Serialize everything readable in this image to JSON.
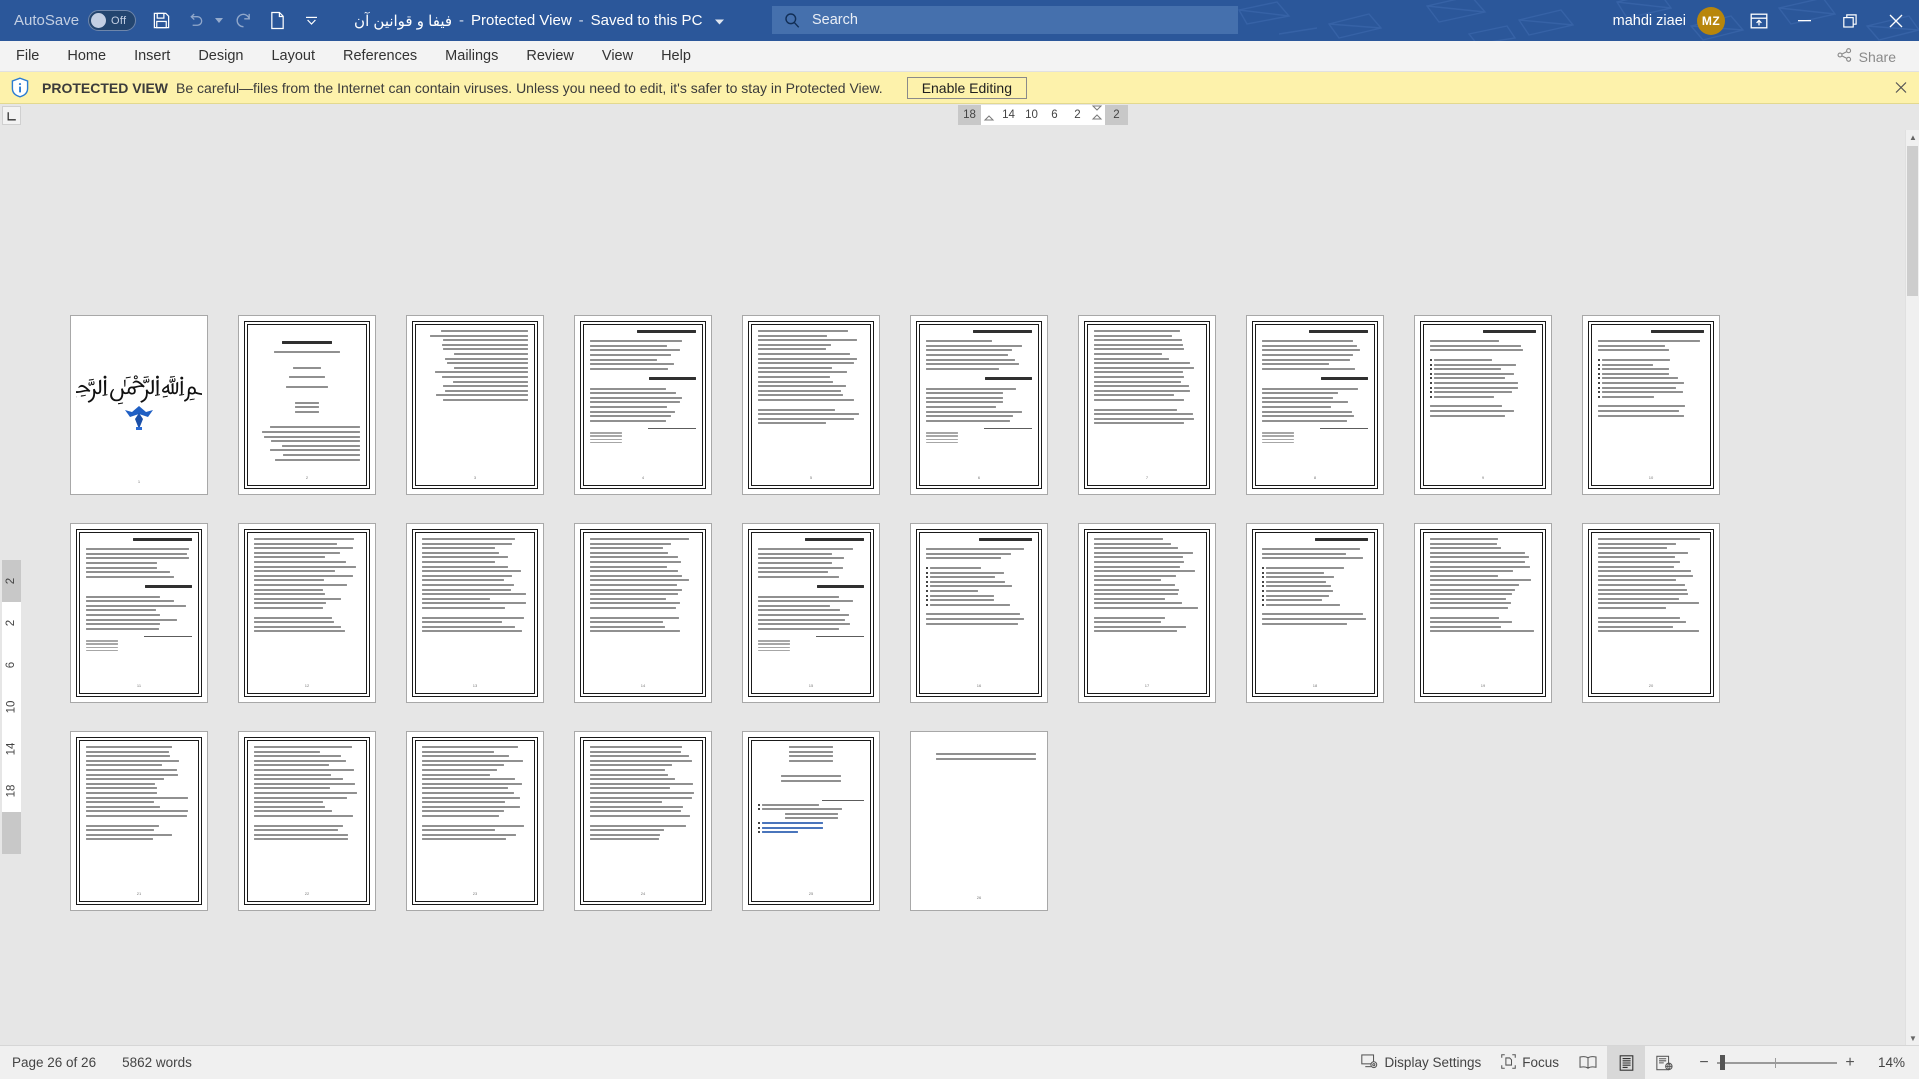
{
  "titlebar": {
    "autosave_label": "AutoSave",
    "autosave_state": "Off",
    "save_icon": "save-icon",
    "undo_icon": "undo-icon",
    "redo_icon": "redo-icon",
    "new_icon": "new-document-icon",
    "customize_icon": "customize-quick-access-toolbar-icon",
    "doc_name": "فیفا و قوانین آن",
    "sep": "-",
    "protected_view": "Protected View",
    "save_location": "Saved to this PC",
    "username": "mahdi ziaei",
    "avatar_initials": "MZ",
    "avatar_color": "#b8860b",
    "bar_color": "#2b579a",
    "ribbon_display_icon": "ribbon-display-options-icon",
    "minimize_icon": "minimize-icon",
    "restore_icon": "restore-icon",
    "close_icon": "close-icon"
  },
  "search": {
    "placeholder": "Search",
    "icon": "search-icon"
  },
  "ribbon": {
    "tabs": [
      {
        "label": "File"
      },
      {
        "label": "Home"
      },
      {
        "label": "Insert"
      },
      {
        "label": "Design"
      },
      {
        "label": "Layout"
      },
      {
        "label": "References"
      },
      {
        "label": "Mailings"
      },
      {
        "label": "Review"
      },
      {
        "label": "View"
      },
      {
        "label": "Help"
      }
    ],
    "share_label": "Share",
    "share_icon": "share-icon"
  },
  "protected_view_bar": {
    "icon": "shield-info-icon",
    "title": "PROTECTED VIEW",
    "message": "Be careful—files from the Internet can contain viruses. Unless you need to edit, it's safer to stay in Protected View.",
    "button_label": "Enable Editing",
    "close_icon": "close-icon",
    "background": "#fdf2ab"
  },
  "rulers": {
    "corner_icon": "tab-selector-icon",
    "horizontal_ticks": [
      "18",
      "14",
      "10",
      "6",
      "2",
      "2"
    ],
    "vertical_ticks": [
      "2",
      "2",
      "6",
      "10",
      "14",
      "18"
    ]
  },
  "statusbar": {
    "page_info": "Page 26 of 26",
    "word_count": "5862 words",
    "display_settings_label": "Display Settings",
    "display_settings_icon": "display-settings-icon",
    "focus_label": "Focus",
    "focus_icon": "focus-icon",
    "read_mode_icon": "read-mode-icon",
    "print_layout_icon": "print-layout-icon",
    "web_layout_icon": "web-layout-icon",
    "zoom_out_icon": "zoom-out-icon",
    "zoom_in_icon": "zoom-in-icon",
    "zoom_level": "14%"
  },
  "document": {
    "total_pages": 26,
    "pages": [
      {
        "n": 1,
        "type": "cover",
        "bismillah": "﷽"
      },
      {
        "n": 2,
        "type": "title"
      },
      {
        "n": 3,
        "type": "toc"
      },
      {
        "n": 4,
        "type": "body-heading"
      },
      {
        "n": 5,
        "type": "body"
      },
      {
        "n": 6,
        "type": "body-heading"
      },
      {
        "n": 7,
        "type": "body"
      },
      {
        "n": 8,
        "type": "body-heading"
      },
      {
        "n": 9,
        "type": "list"
      },
      {
        "n": 10,
        "type": "list"
      },
      {
        "n": 11,
        "type": "body-heading"
      },
      {
        "n": 12,
        "type": "body"
      },
      {
        "n": 13,
        "type": "body"
      },
      {
        "n": 14,
        "type": "body"
      },
      {
        "n": 15,
        "type": "body-heading"
      },
      {
        "n": 16,
        "type": "list"
      },
      {
        "n": 17,
        "type": "body"
      },
      {
        "n": 18,
        "type": "list"
      },
      {
        "n": 19,
        "type": "body"
      },
      {
        "n": 20,
        "type": "body"
      },
      {
        "n": 21,
        "type": "body"
      },
      {
        "n": 22,
        "type": "body"
      },
      {
        "n": 23,
        "type": "body"
      },
      {
        "n": 24,
        "type": "body"
      },
      {
        "n": 25,
        "type": "references"
      },
      {
        "n": 26,
        "type": "last"
      }
    ]
  }
}
